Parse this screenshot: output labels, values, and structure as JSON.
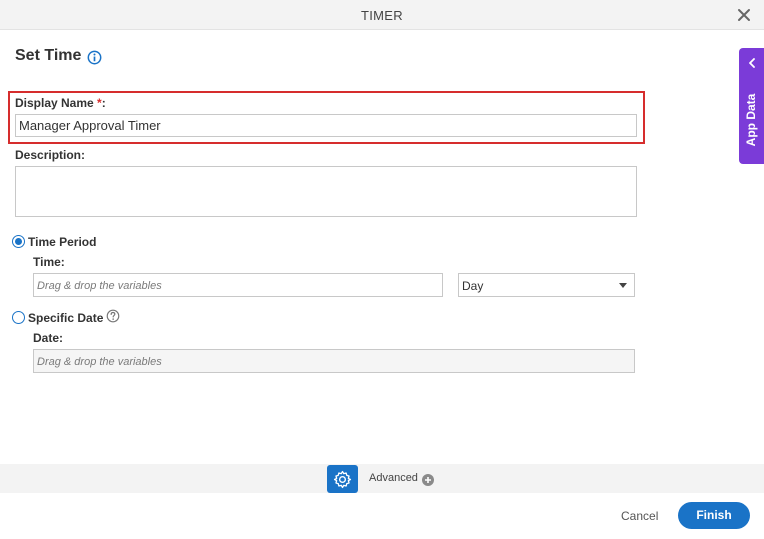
{
  "dialog": {
    "title": "TIMER"
  },
  "header": {
    "heading": "Set Time"
  },
  "display_name": {
    "label": "Display Name",
    "required_mark": "*",
    "colon": ":",
    "value": "Manager Approval Timer"
  },
  "description": {
    "label": "Description:",
    "value": ""
  },
  "time_period": {
    "label": "Time Period",
    "selected": true,
    "time_label": "Time:",
    "time_placeholder": "Drag & drop the variables",
    "unit_value": "Day"
  },
  "specific_date": {
    "label": "Specific Date",
    "selected": false,
    "date_label": "Date:",
    "date_placeholder": "Drag & drop the variables"
  },
  "side_panel": {
    "label": "App Data"
  },
  "advanced": {
    "label": "Advanced"
  },
  "footer": {
    "cancel_label": "Cancel",
    "finish_label": "Finish"
  },
  "colors": {
    "accent": "#1a73c7",
    "side_tab": "#7b3bd8",
    "highlight": "#d62d2d"
  },
  "icons": [
    "close-icon",
    "info-icon",
    "help-icon",
    "chevron-left-icon",
    "gear-icon",
    "plus-circle-icon"
  ]
}
